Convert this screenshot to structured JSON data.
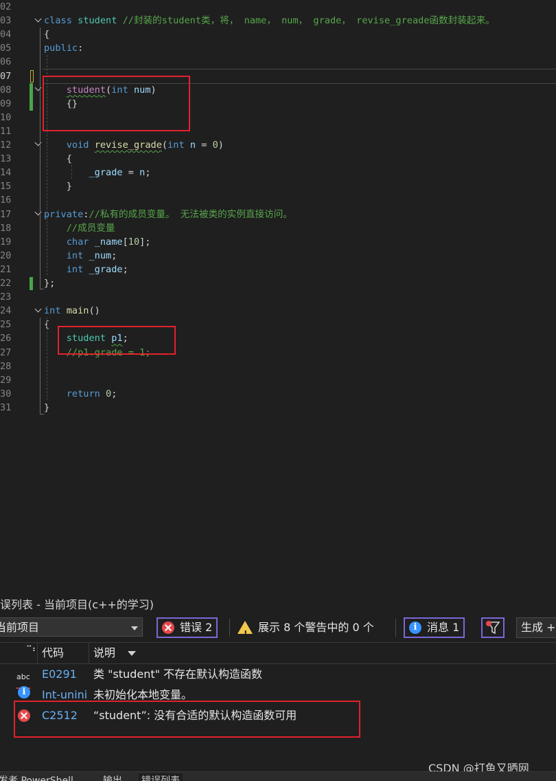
{
  "editor": {
    "lines": [
      {
        "n": "02",
        "parts": []
      },
      {
        "n": "03",
        "parts": [
          {
            "t": "class ",
            "c": "kw"
          },
          {
            "t": "student ",
            "c": "cls"
          },
          {
            "t": "//封装的student类，将， name， num， grade， revise_greade函数封装起来。",
            "c": "cm"
          }
        ]
      },
      {
        "n": "04",
        "parts": [
          {
            "t": "{",
            "c": "pun"
          }
        ]
      },
      {
        "n": "05",
        "parts": [
          {
            "t": "public",
            "c": "kw"
          },
          {
            "t": ":",
            "c": "pun"
          }
        ]
      },
      {
        "n": "06",
        "parts": []
      },
      {
        "n": "07",
        "parts": []
      },
      {
        "n": "08",
        "parts": [
          {
            "t": "    "
          },
          {
            "t": "student",
            "c": "ctor squig"
          },
          {
            "t": "(",
            "c": "pun"
          },
          {
            "t": "int",
            "c": "kw"
          },
          {
            "t": " num",
            "c": "var"
          },
          {
            "t": ")",
            "c": "pun"
          }
        ]
      },
      {
        "n": "09",
        "parts": [
          {
            "t": "    "
          },
          {
            "t": "{}",
            "c": "pun"
          }
        ]
      },
      {
        "n": "10",
        "parts": []
      },
      {
        "n": "11",
        "parts": []
      },
      {
        "n": "12",
        "parts": [
          {
            "t": "    "
          },
          {
            "t": "void",
            "c": "kw"
          },
          {
            "t": " "
          },
          {
            "t": "revise_grade",
            "c": "fn squig"
          },
          {
            "t": "(",
            "c": "pun"
          },
          {
            "t": "int",
            "c": "kw"
          },
          {
            "t": " n",
            "c": "var"
          },
          {
            "t": " = ",
            "c": "pun"
          },
          {
            "t": "0",
            "c": "num"
          },
          {
            "t": ")",
            "c": "pun"
          }
        ]
      },
      {
        "n": "13",
        "parts": [
          {
            "t": "    "
          },
          {
            "t": "{",
            "c": "pun"
          }
        ]
      },
      {
        "n": "14",
        "parts": [
          {
            "t": "        "
          },
          {
            "t": "_grade",
            "c": "var"
          },
          {
            "t": " = ",
            "c": "pun"
          },
          {
            "t": "n",
            "c": "var"
          },
          {
            "t": ";",
            "c": "pun"
          }
        ]
      },
      {
        "n": "15",
        "parts": [
          {
            "t": "    "
          },
          {
            "t": "}",
            "c": "pun"
          }
        ]
      },
      {
        "n": "16",
        "parts": []
      },
      {
        "n": "17",
        "parts": [
          {
            "t": "private",
            "c": "kw"
          },
          {
            "t": ":",
            "c": "pun"
          },
          {
            "t": "//私有的成员变量。 无法被类的实例直接访问。",
            "c": "cm"
          }
        ]
      },
      {
        "n": "18",
        "parts": [
          {
            "t": "    "
          },
          {
            "t": "//成员变量",
            "c": "cm"
          }
        ]
      },
      {
        "n": "19",
        "parts": [
          {
            "t": "    "
          },
          {
            "t": "char",
            "c": "kw"
          },
          {
            "t": " _name",
            "c": "var"
          },
          {
            "t": "[",
            "c": "pun"
          },
          {
            "t": "10",
            "c": "num"
          },
          {
            "t": "];",
            "c": "pun"
          }
        ]
      },
      {
        "n": "20",
        "parts": [
          {
            "t": "    "
          },
          {
            "t": "int",
            "c": "kw"
          },
          {
            "t": " _num",
            "c": "var"
          },
          {
            "t": ";",
            "c": "pun"
          }
        ]
      },
      {
        "n": "21",
        "parts": [
          {
            "t": "    "
          },
          {
            "t": "int",
            "c": "kw"
          },
          {
            "t": " _grade",
            "c": "var"
          },
          {
            "t": ";",
            "c": "pun"
          }
        ]
      },
      {
        "n": "22",
        "parts": [
          {
            "t": "};",
            "c": "pun"
          }
        ]
      },
      {
        "n": "23",
        "parts": []
      },
      {
        "n": "24",
        "parts": [
          {
            "t": "int",
            "c": "kw"
          },
          {
            "t": " "
          },
          {
            "t": "main",
            "c": "fn"
          },
          {
            "t": "()",
            "c": "pun"
          }
        ]
      },
      {
        "n": "25",
        "parts": [
          {
            "t": "{",
            "c": "pun"
          }
        ]
      },
      {
        "n": "26",
        "parts": [
          {
            "t": "    "
          },
          {
            "t": "student",
            "c": "cls"
          },
          {
            "t": " "
          },
          {
            "t": "p1",
            "c": "var squig"
          },
          {
            "t": ";",
            "c": "pun"
          }
        ]
      },
      {
        "n": "27",
        "parts": [
          {
            "t": "    "
          },
          {
            "t": "//p1.grade = 1;",
            "c": "cm"
          }
        ]
      },
      {
        "n": "28",
        "parts": []
      },
      {
        "n": "29",
        "parts": []
      },
      {
        "n": "30",
        "parts": [
          {
            "t": "    "
          },
          {
            "t": "return",
            "c": "kw"
          },
          {
            "t": " "
          },
          {
            "t": "0",
            "c": "num"
          },
          {
            "t": ";",
            "c": "pun"
          }
        ]
      },
      {
        "n": "31",
        "parts": [
          {
            "t": "}",
            "c": "pun"
          }
        ]
      }
    ]
  },
  "error_list": {
    "title": "误列表 - 当前项目(c++的学习)",
    "scope": "当前项目",
    "errors_label": "错误 2",
    "warnings_label": "展示 8 个警告中的 0 个",
    "messages_label": "消息 1",
    "build_label": "生成 +",
    "col_code": "代码",
    "col_desc": "说明",
    "rows": [
      {
        "icon": "spell-icon",
        "icon_text": "abc",
        "code": "E0291",
        "desc": "类 \"student\" 不存在默认构造函数"
      },
      {
        "icon": "info-icon",
        "code": "Int-unini",
        "desc": "未初始化本地变量。"
      },
      {
        "icon": "error-icon",
        "code": "C2512",
        "desc": "“student”: 没有合适的默认构造函数可用"
      }
    ],
    "tabs": [
      "发者 PowerShell",
      "输出",
      "错误列表"
    ]
  },
  "watermark": "CSDN @打鱼又晒网"
}
